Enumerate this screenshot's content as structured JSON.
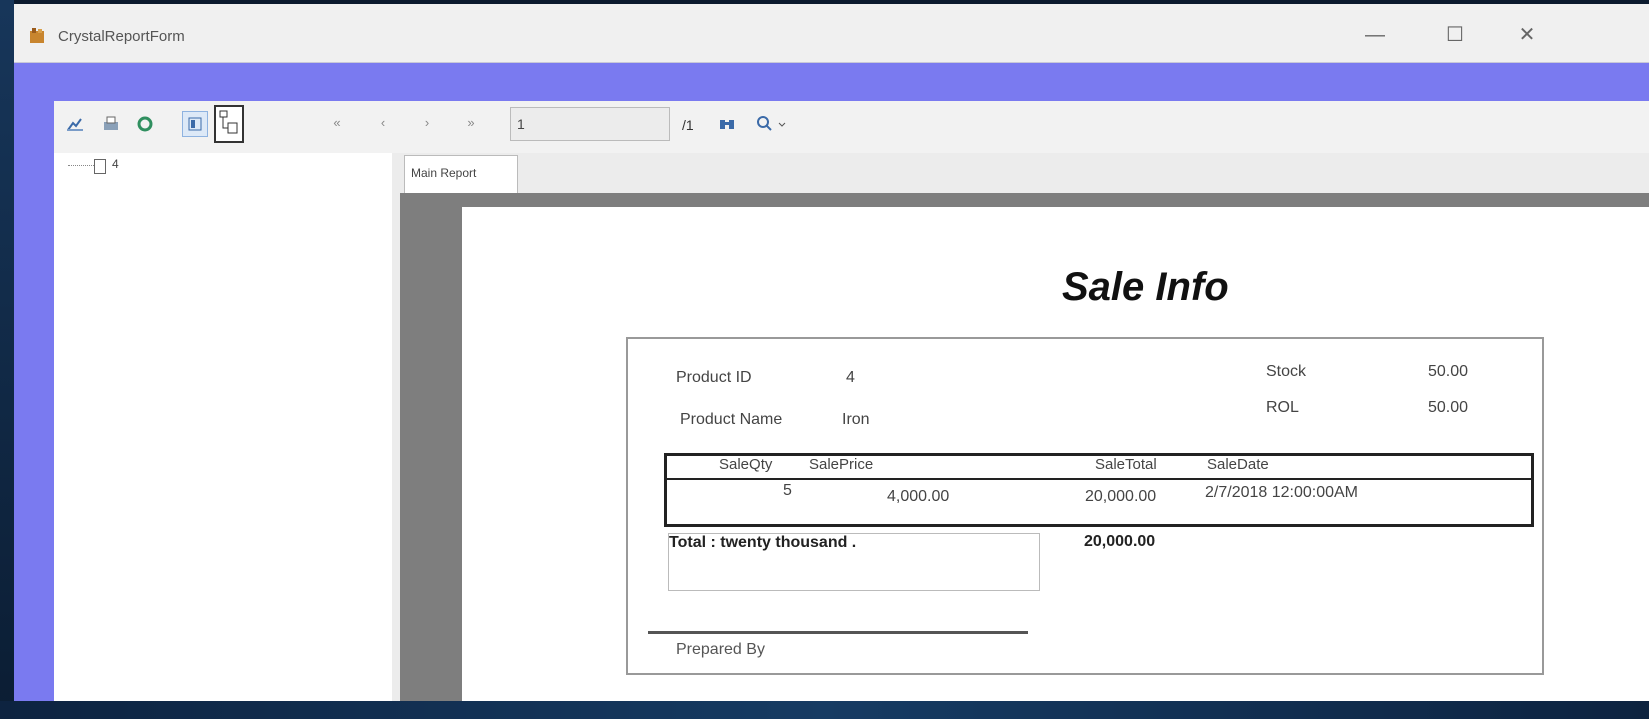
{
  "window": {
    "title": "CrystalReportForm",
    "minimize_glyph": "—",
    "maximize_glyph": "☐",
    "close_glyph": "✕"
  },
  "toolbar": {
    "page_value": "1",
    "page_total": "/1",
    "icons": [
      "export-icon",
      "print-icon",
      "refresh-icon",
      "toggle-parameter-panel-icon",
      "toggle-group-tree-icon",
      "first-page-icon",
      "previous-page-icon",
      "next-page-icon",
      "last-page-icon",
      "find-icon",
      "zoom-icon"
    ]
  },
  "group_tree": {
    "item": "4"
  },
  "tabs": {
    "main": "Main Report"
  },
  "report": {
    "title": "Sale Info",
    "product_id_label": "Product ID",
    "product_id_value": "4",
    "product_name_label": "Product Name",
    "product_name_value": "Iron",
    "stock_label": "Stock",
    "stock_value": "50.00",
    "rol_label": "ROL",
    "rol_value": "50.00",
    "table": {
      "headers": [
        "SaleQty",
        "SalePrice",
        "SaleTotal",
        "SaleDate"
      ],
      "row": [
        "5",
        "4,000.00",
        "20,000.00",
        "2/7/2018  12:00:00AM"
      ]
    },
    "total_text": "Total : twenty thousand .",
    "total_value": "20,000.00",
    "prepared_by": "Prepared By"
  },
  "colors": {
    "window_frame": "#7a7af0",
    "preview_background": "#7e7e7e"
  }
}
